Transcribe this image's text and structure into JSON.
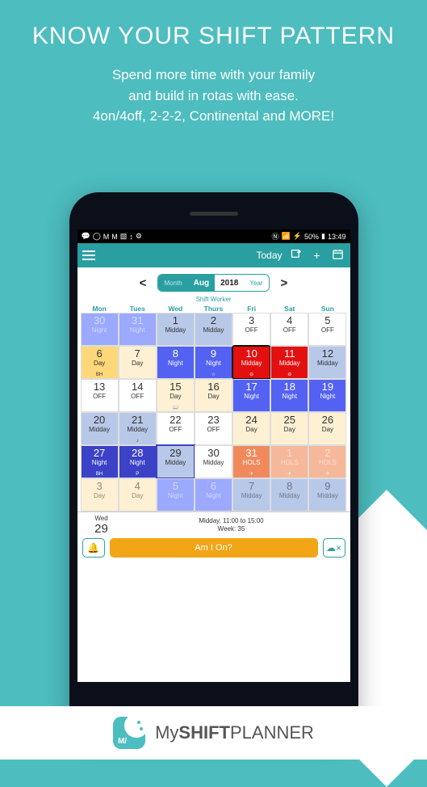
{
  "hero": {
    "title": "KNOW YOUR SHIFT PATTERN",
    "line1": "Spend more time with your family",
    "line2": "and build in rotas with ease.",
    "line3": "4on/4off, 2-2-2, Continental and MORE!"
  },
  "statusbar": {
    "battery": "50%",
    "time": "13:49"
  },
  "appbar": {
    "today": "Today"
  },
  "nav": {
    "monthLabel": "Month",
    "month": "Aug",
    "year": "2018",
    "yearLabel": "Year",
    "chevL": "<",
    "chevR": ">"
  },
  "profile": "Shift Worker",
  "dow": [
    "Mon",
    "Tues",
    "Wed",
    "Thurs",
    "Fri",
    "Sat",
    "Sun"
  ],
  "weeks": [
    [
      {
        "n": "30",
        "s": "Night",
        "c": "c-pblue",
        "dim": true
      },
      {
        "n": "31",
        "s": "Night",
        "c": "c-pblue",
        "dim": true
      },
      {
        "n": "1",
        "s": "Midday",
        "c": "c-lblue"
      },
      {
        "n": "2",
        "s": "Midday",
        "c": "c-lblue"
      },
      {
        "n": "3",
        "s": "OFF",
        "c": "c-off"
      },
      {
        "n": "4",
        "s": "OFF",
        "c": "c-off"
      },
      {
        "n": "5",
        "s": "OFF",
        "c": "c-off"
      }
    ],
    [
      {
        "n": "6",
        "s": "Day",
        "c": "c-yel",
        "b": "BH"
      },
      {
        "n": "7",
        "s": "Day",
        "c": "c-lyel"
      },
      {
        "n": "8",
        "s": "Night",
        "c": "c-blue"
      },
      {
        "n": "9",
        "s": "Night",
        "c": "c-blue",
        "b": "☆"
      },
      {
        "n": "10",
        "s": "Midday",
        "c": "c-red",
        "b": "⊖",
        "out": true
      },
      {
        "n": "11",
        "s": "Midday",
        "c": "c-red",
        "b": "⊖"
      },
      {
        "n": "12",
        "s": "Midday",
        "c": "c-lblue"
      }
    ],
    [
      {
        "n": "13",
        "s": "OFF",
        "c": "c-off"
      },
      {
        "n": "14",
        "s": "OFF",
        "c": "c-off"
      },
      {
        "n": "15",
        "s": "Day",
        "c": "c-lyel",
        "b": "📖"
      },
      {
        "n": "16",
        "s": "Day",
        "c": "c-lyel"
      },
      {
        "n": "17",
        "s": "Night",
        "c": "c-blue"
      },
      {
        "n": "18",
        "s": "Night",
        "c": "c-blue"
      },
      {
        "n": "19",
        "s": "Night",
        "c": "c-blue"
      }
    ],
    [
      {
        "n": "20",
        "s": "Midday",
        "c": "c-lblue"
      },
      {
        "n": "21",
        "s": "Midday",
        "c": "c-lblue",
        "b": "♪"
      },
      {
        "n": "22",
        "s": "OFF",
        "c": "c-off"
      },
      {
        "n": "23",
        "s": "OFF",
        "c": "c-off"
      },
      {
        "n": "24",
        "s": "Day",
        "c": "c-lyel"
      },
      {
        "n": "25",
        "s": "Day",
        "c": "c-lyel"
      },
      {
        "n": "26",
        "s": "Day",
        "c": "c-lyel"
      }
    ],
    [
      {
        "n": "27",
        "s": "Night",
        "c": "c-dblue",
        "b": "BH"
      },
      {
        "n": "28",
        "s": "Night",
        "c": "c-dblue",
        "b": "P"
      },
      {
        "n": "29",
        "s": "Midday",
        "c": "c-lblue",
        "sel": true
      },
      {
        "n": "30",
        "s": "Midday",
        "c": "c-off"
      },
      {
        "n": "31",
        "s": "HOLS",
        "c": "c-orng",
        "b": "✈"
      },
      {
        "n": "1",
        "s": "HOLS",
        "c": "c-lorng",
        "b": "✈",
        "dim": true
      },
      {
        "n": "2",
        "s": "HOLS",
        "c": "c-lorng",
        "b": "✈",
        "dim": true
      }
    ],
    [
      {
        "n": "3",
        "s": "Day",
        "c": "c-lyel",
        "dim": true
      },
      {
        "n": "4",
        "s": "Day",
        "c": "c-lyel",
        "dim": true
      },
      {
        "n": "5",
        "s": "Night",
        "c": "c-pblue",
        "dim": true
      },
      {
        "n": "6",
        "s": "Night",
        "c": "c-pblue",
        "dim": true
      },
      {
        "n": "7",
        "s": "Midday",
        "c": "c-lblue",
        "dim": true
      },
      {
        "n": "8",
        "s": "Midday",
        "c": "c-lblue",
        "dim": true
      },
      {
        "n": "9",
        "s": "Midday",
        "c": "c-lblue",
        "dim": true
      }
    ]
  ],
  "detail": {
    "dow": "Wed",
    "date": "29",
    "line1": "Midday, 11:00 to 15:00",
    "line2": "Week: 35"
  },
  "actions": {
    "amion": "Am I On?"
  },
  "footer": {
    "brand1": "My",
    "brand2": "SHIFT",
    "brand3": "PLANNER",
    "logo": "M/"
  }
}
